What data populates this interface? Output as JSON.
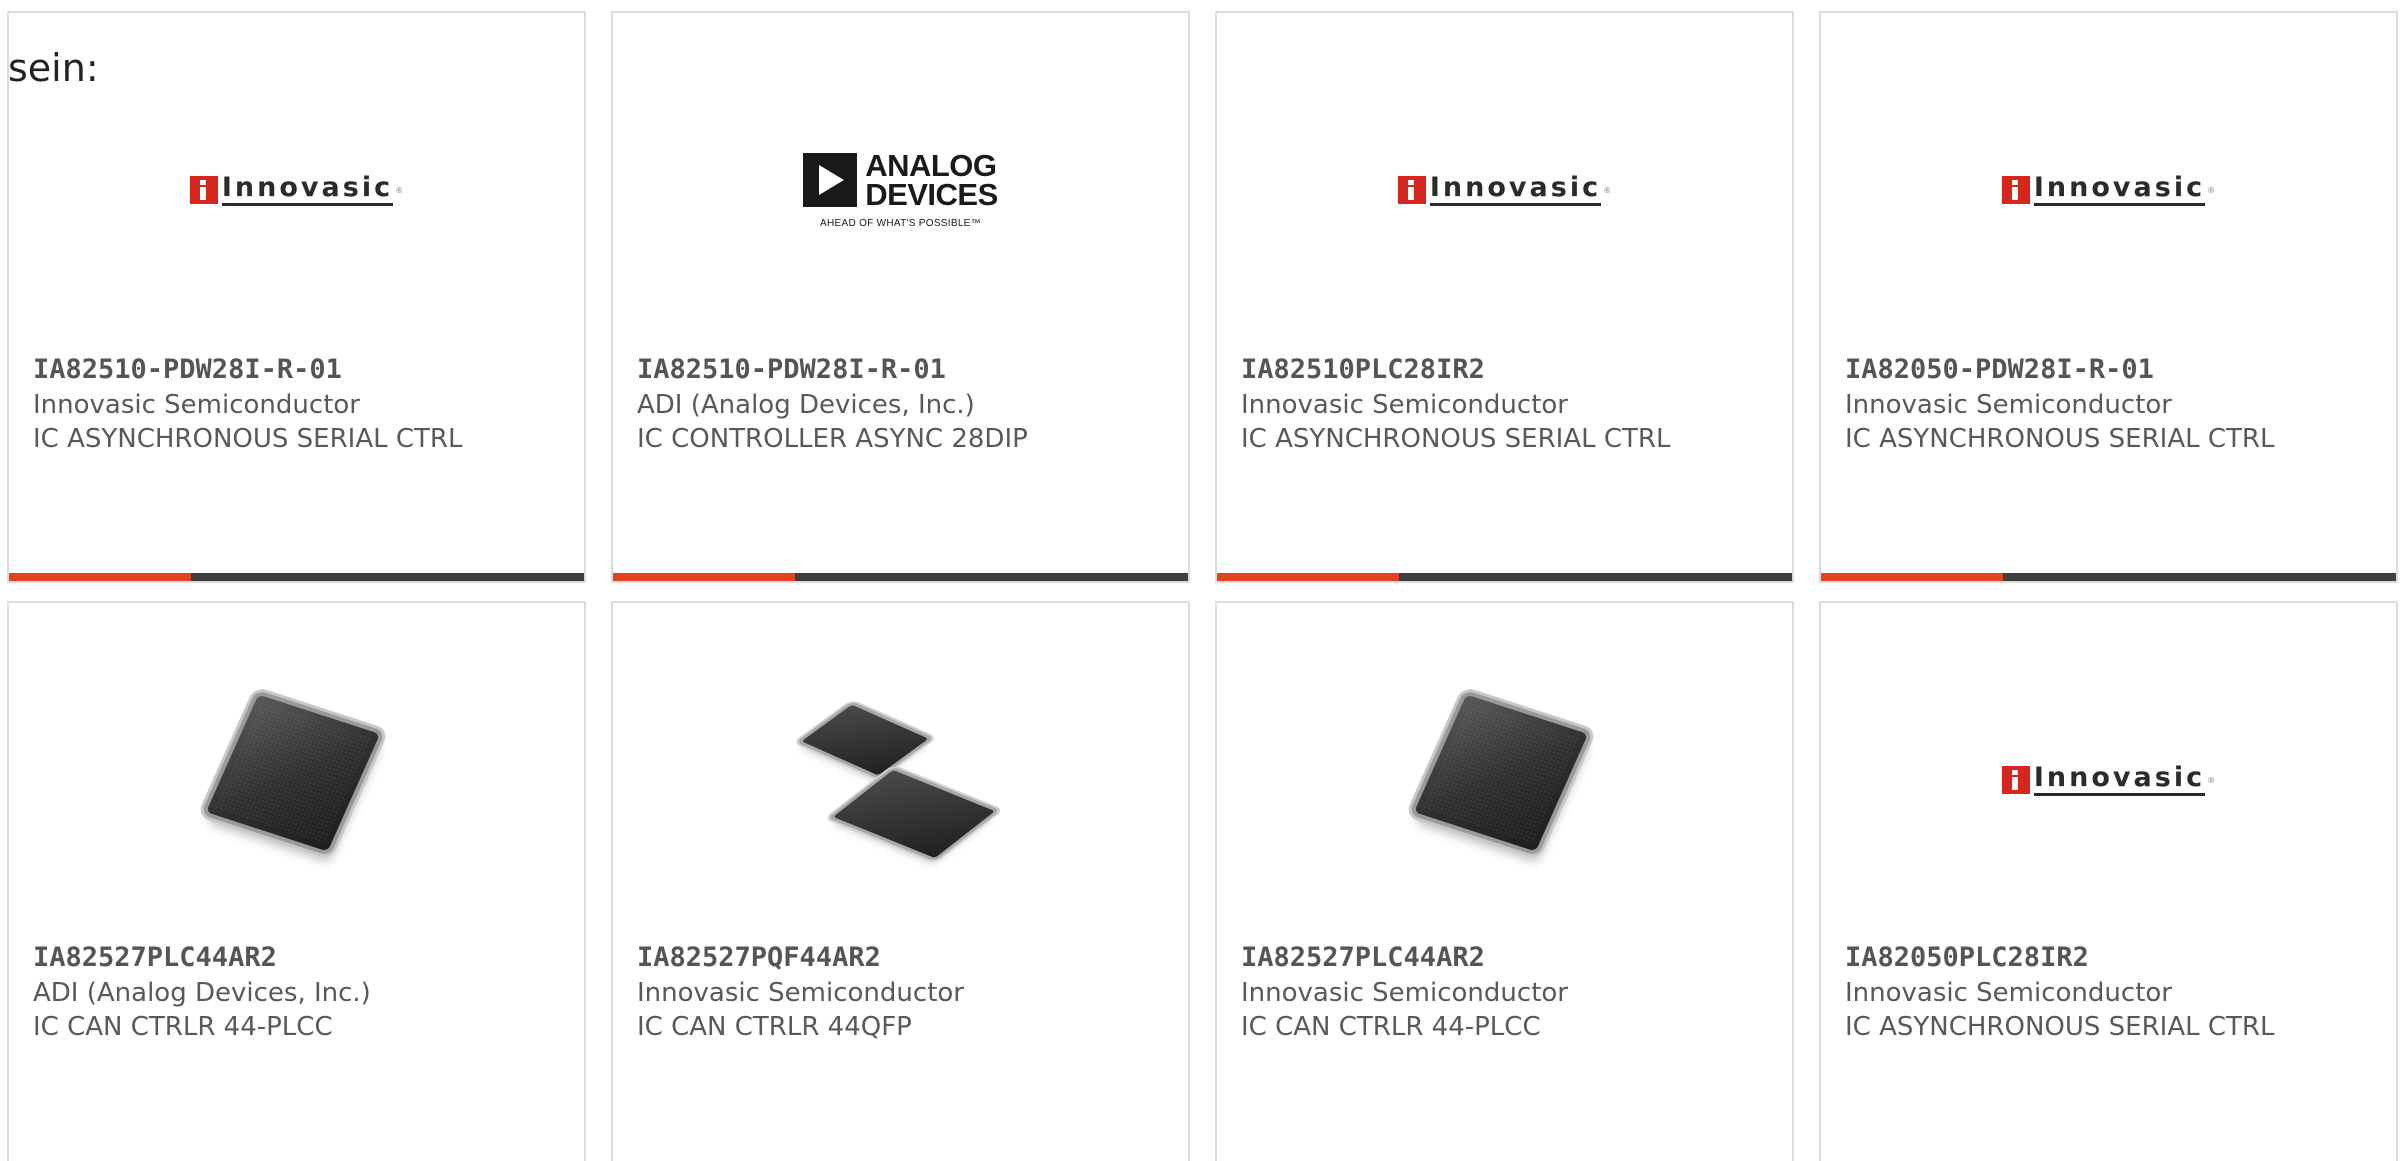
{
  "intro_text": "sein:",
  "colors": {
    "accent_bar": "#e0431e",
    "bar": "#3d3f41",
    "card_border": "#dcdcdc",
    "text": "#595959"
  },
  "products": [
    {
      "part_number": "IA82510-PDW28I-R-01",
      "manufacturer": "Innovasic Semiconductor",
      "description": "IC ASYNCHRONOUS SERIAL CTRL",
      "image": "innovasic-logo",
      "logo_text": "Innovasic"
    },
    {
      "part_number": "IA82510-PDW28I-R-01",
      "manufacturer": "ADI (Analog Devices, Inc.)",
      "description": "IC CONTROLLER ASYNC 28DIP",
      "image": "analog-devices-logo",
      "logo_text": "ANALOG DEVICES",
      "logo_line1": "ANALOG",
      "logo_line2": "DEVICES",
      "logo_tagline": "AHEAD OF WHAT'S POSSIBLE™"
    },
    {
      "part_number": "IA82510PLC28IR2",
      "manufacturer": "Innovasic Semiconductor",
      "description": "IC ASYNCHRONOUS SERIAL CTRL",
      "image": "innovasic-logo",
      "logo_text": "Innovasic"
    },
    {
      "part_number": "IA82050-PDW28I-R-01",
      "manufacturer": "Innovasic Semiconductor",
      "description": "IC ASYNCHRONOUS SERIAL CTRL",
      "image": "innovasic-logo",
      "logo_text": "Innovasic"
    },
    {
      "part_number": "IA82527PLC44AR2",
      "manufacturer": "ADI (Analog Devices, Inc.)",
      "description": "IC CAN CTRLR 44-PLCC",
      "image": "plcc-chip-photo"
    },
    {
      "part_number": "IA82527PQF44AR2",
      "manufacturer": "Innovasic Semiconductor",
      "description": "IC CAN CTRLR 44QFP",
      "image": "qfp-chip-photo"
    },
    {
      "part_number": "IA82527PLC44AR2",
      "manufacturer": "Innovasic Semiconductor",
      "description": "IC CAN CTRLR 44-PLCC",
      "image": "plcc-chip-photo"
    },
    {
      "part_number": "IA82050PLC28IR2",
      "manufacturer": "Innovasic Semiconductor",
      "description": "IC ASYNCHRONOUS SERIAL CTRL",
      "image": "innovasic-logo",
      "logo_text": "Innovasic"
    }
  ]
}
